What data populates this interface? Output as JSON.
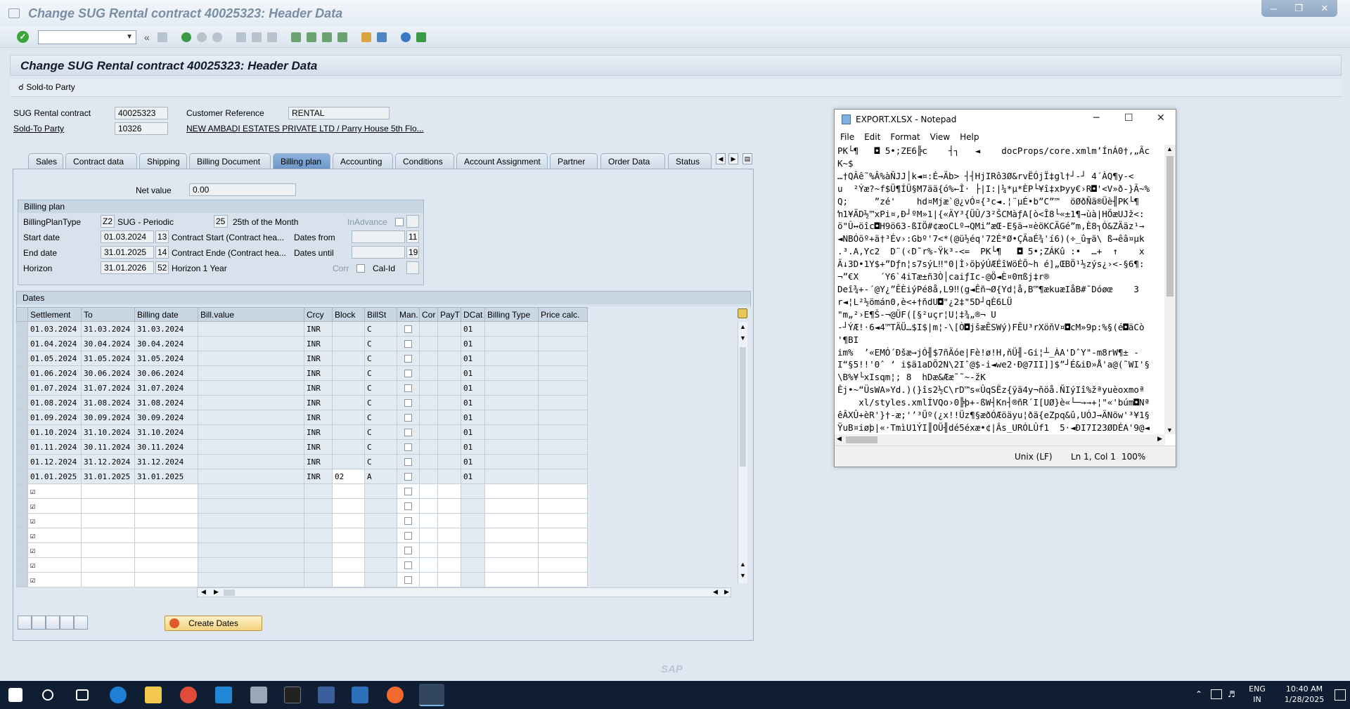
{
  "window": {
    "title": "Change SUG Rental contract 40025323: Header Data"
  },
  "app_title": "Change SUG Rental contract 40025323: Header Data",
  "app_toolbar": {
    "sold_to_party": "Sold-to Party"
  },
  "header": {
    "contract_label": "SUG Rental contract",
    "contract_value": "40025323",
    "customer_ref_label": "Customer Reference",
    "customer_ref_value": "RENTAL",
    "sold_to_label": "Sold-To Party",
    "sold_to_value": "10326",
    "sold_to_name": "NEW AMBADI ESTATES PRIVATE LTD / Parry House 5th Flo..."
  },
  "tabs": [
    "Sales",
    "Contract data",
    "Shipping",
    "Billing Document",
    "Billing plan",
    "Accounting",
    "Conditions",
    "Account Assignment",
    "Partner",
    "Order Data",
    "Status"
  ],
  "active_tab": "Billing plan",
  "net_value": {
    "label": "Net value",
    "value": "0.00"
  },
  "billing_plan": {
    "group_title": "Billing plan",
    "type_label": "BillingPlanType",
    "type_code": "Z2",
    "type_text": "SUG - Periodic",
    "rule_code": "25",
    "rule_text": "25th of the Month",
    "inadvance_label": "InAdvance",
    "start_label": "Start date",
    "start_value": "01.03.2024",
    "start_code": "13",
    "start_text": "Contract Start (Contract hea...",
    "dates_from_label": "Dates from",
    "dates_from_code": "11",
    "end_label": "End date",
    "end_value": "31.01.2025",
    "end_code": "14",
    "end_text": "Contract Ende (Contract hea...",
    "dates_until_label": "Dates until",
    "dates_until_code": "19",
    "horizon_label": "Horizon",
    "horizon_value": "31.01.2026",
    "horizon_code": "52",
    "horizon_text": "Horizon 1 Year",
    "corr_label": "Corr",
    "calid_label": "Cal-Id"
  },
  "dates": {
    "title": "Dates",
    "columns": [
      "Settlement",
      "To",
      "Billing date",
      "Bill.value",
      "Crcy",
      "Block",
      "BillSt",
      "Man.",
      "Cor",
      "PayT",
      "DCat",
      "Billing Type",
      "Price calc."
    ],
    "rows": [
      [
        "01.03.2024",
        "31.03.2024",
        "31.03.2024",
        "",
        "INR",
        "",
        "C",
        "",
        "",
        "",
        "01",
        "",
        ""
      ],
      [
        "01.04.2024",
        "30.04.2024",
        "30.04.2024",
        "",
        "INR",
        "",
        "C",
        "",
        "",
        "",
        "01",
        "",
        ""
      ],
      [
        "01.05.2024",
        "31.05.2024",
        "31.05.2024",
        "",
        "INR",
        "",
        "C",
        "",
        "",
        "",
        "01",
        "",
        ""
      ],
      [
        "01.06.2024",
        "30.06.2024",
        "30.06.2024",
        "",
        "INR",
        "",
        "C",
        "",
        "",
        "",
        "01",
        "",
        ""
      ],
      [
        "01.07.2024",
        "31.07.2024",
        "31.07.2024",
        "",
        "INR",
        "",
        "C",
        "",
        "",
        "",
        "01",
        "",
        ""
      ],
      [
        "01.08.2024",
        "31.08.2024",
        "31.08.2024",
        "",
        "INR",
        "",
        "C",
        "",
        "",
        "",
        "01",
        "",
        ""
      ],
      [
        "01.09.2024",
        "30.09.2024",
        "30.09.2024",
        "",
        "INR",
        "",
        "C",
        "",
        "",
        "",
        "01",
        "",
        ""
      ],
      [
        "01.10.2024",
        "31.10.2024",
        "31.10.2024",
        "",
        "INR",
        "",
        "C",
        "",
        "",
        "",
        "01",
        "",
        ""
      ],
      [
        "01.11.2024",
        "30.11.2024",
        "30.11.2024",
        "",
        "INR",
        "",
        "C",
        "",
        "",
        "",
        "01",
        "",
        ""
      ],
      [
        "01.12.2024",
        "31.12.2024",
        "31.12.2024",
        "",
        "INR",
        "",
        "C",
        "",
        "",
        "",
        "01",
        "",
        ""
      ],
      [
        "01.01.2025",
        "31.01.2025",
        "31.01.2025",
        "",
        "INR",
        "02",
        "A",
        "",
        "",
        "",
        "01",
        "",
        ""
      ]
    ],
    "empty_rows": 7,
    "create_button": "Create Dates"
  },
  "notepad": {
    "title": "EXPORT.XLSX - Notepad",
    "menu": [
      "File",
      "Edit",
      "Format",
      "View",
      "Help"
    ],
    "lines": [
      "PK└¶   ◘ 5•;ZE6╠c    ┤┐   ◄    docProps/core.xmlm’ÍnÁ0†,„Ãc",
      "K~$",
      "…†QÂê˜%Â%àÑJJ│k◄¤:É→Äb> ┤┤HjIRô3Ø&rvËÓjÏ‡gl†┘-┘ 4´ÀQ¶y-<",
      "u  ²Ýæ?~f$Ü¶ÍÜ§M7ää{ó%←Î· ├|I:|¼*µ*ÈP└¥î‡xÞyy€›R◘'<V»ð-}Ã~%",
      "Q;     ”zé'    hd¤Mjæ`@¿vÓ¤{³c◄.¦¨µÉ•b”C”™  öØðÑä®Üè╢PK└¶",
      "ŉ1¥ÄD½™xPi¤,Ð┘ºM»1|{«ÄY³{ÜÛ/3²ŠCMàƒA[ò<Î8└«±1¶→ùà|HÖæUJž<:",
      "ö\"Û↔öîc◘H9ö63-ßIÖ#¢æoCLº→QMi”æŒ-E§ä→¤èöKCÄGé”m,È8┐Ó&ZÄäz¹→",
      "◄NBÓöº+ä†³Év›:Gbº'7<*(@ü½éq'72É*Ø•ÇÃaÉ¾'í6)(÷_û╥ä\\ ß→êâ¤µk",
      ".³.A,Yc2  D¨(‹D˜r%-Ÿk³-<=  PK└¶   ◘ 5•;ZÁKû :•  …+  ↑    x",
      "Ã↓3D•1Y$+”Dƒn¦s7sýL‼\"0|Ì›õþýÚÆÉîWöÉÕ~h é]„ŒBÖ¹½zýs¿›<-§6¶:",
      "¬”€X    ´Y6`4iTæ±ñ3Ò│caiƒIc-@Ö◄È¤0πßj‡r®",
      "Deî¾+-´@Y¿”ÊÈiýPé8å,L9‼(g◄Êñ¬Ø{Yd¦å,B™¶ækuæIåB#˜Dóøœ    3",
      "r◄¦L²½ömán0,è<+†ňdU◘\"¿2‡\"5D┘qÈ6LÜ",
      "\"m„²›E¶Š-¬@ÜF([§²uçr¦U¦‡¾„®¬ U",
      "-┘ÝÆ!·6◄4™TÄÜ…$I$|m¦-\\[Ò◘jšæÊSWý)FÊU³rXöňV¤◘cM»9p:%§(é◘äCò",
      "'¶BI",
      "im%  ’«EMÓ´Ðšæ→jÓ╢$7ñÄóe|Fè!ø!H,ňÜ╢-Gi¦┴_ÀA'DˆY\"-m8rW¶± -",
      "I“§5!!'0ˆ ‘ i$ä1aDÕ2N\\2Iˆ@$-i◄we2·Ð@7II]]$”┘É&iÐ»Å'a@(˜WI'§",
      "\\B%¥└xIsqm¦; 8  hDæ&Ææ˜˜~-žK",
      "Êj•~“ÜsWA»Yd.)(}îs2½C\\rD™s«ÛqSËz{ÿä4y¬ňöå.ÑIýIî%žªyuèoxmoª",
      "    xl/styles.xmlÍVQo›0╠þ+-ßW┤Kn┤®ñR´I[UØ}è«└─→→+¦\"«'búm◘Nª",
      "êÂXÛ+èR'}†-æ;'’³Üº(¿x!!Üz¶§æðÓÆöäyu¦ðä{eZpq&û,UÓJ→ÄNöw'³¥1§",
      "ŸuB¤iøþ|«·TmìU1ÝI║OÜ╢dé5éxæ•¢|Âs_URÓLÛf1  5·◄ÐI7I23ØDÉA'9@◄"
    ],
    "status": {
      "eol": "Unix (LF)",
      "pos": "Ln 1, Col 1",
      "zoom": "100%"
    }
  },
  "sap_logo": "SAP",
  "taskbar": {
    "lang1": "ENG",
    "lang2": "IN",
    "time": "10:40 AM",
    "date": "1/28/2025"
  }
}
